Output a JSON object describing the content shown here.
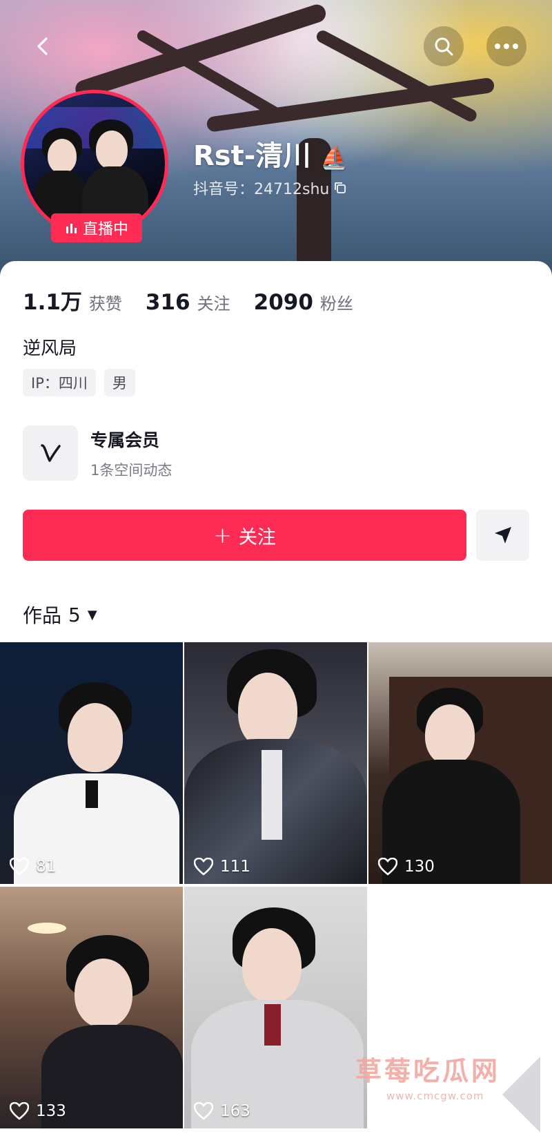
{
  "header": {
    "back_icon": "chevron-left-icon",
    "search_icon": "search-icon",
    "more_icon": "more-dots-icon",
    "live_badge": "直播中",
    "name": "Rst-清川",
    "name_emoji": "⛵",
    "douyin_id": "抖音号：24712shu"
  },
  "stats": [
    {
      "value": "1.1万",
      "label": "获赞"
    },
    {
      "value": "316",
      "label": "关注"
    },
    {
      "value": "2090",
      "label": "粉丝"
    }
  ],
  "bio": "逆风局",
  "tags": [
    "IP：四川",
    "男"
  ],
  "member": {
    "title": "专属会员",
    "subtitle": "1条空间动态"
  },
  "actions": {
    "follow": "关注",
    "follow_plus": "+"
  },
  "works": {
    "label": "作品",
    "count": "5"
  },
  "videos": [
    {
      "likes": "81"
    },
    {
      "likes": "111"
    },
    {
      "likes": "130"
    },
    {
      "likes": "133"
    },
    {
      "likes": "163"
    }
  ],
  "watermark": {
    "main": "草莓吃瓜网",
    "sub": "www.cmcgw.com"
  },
  "colors": {
    "accent": "#fe2c55"
  }
}
